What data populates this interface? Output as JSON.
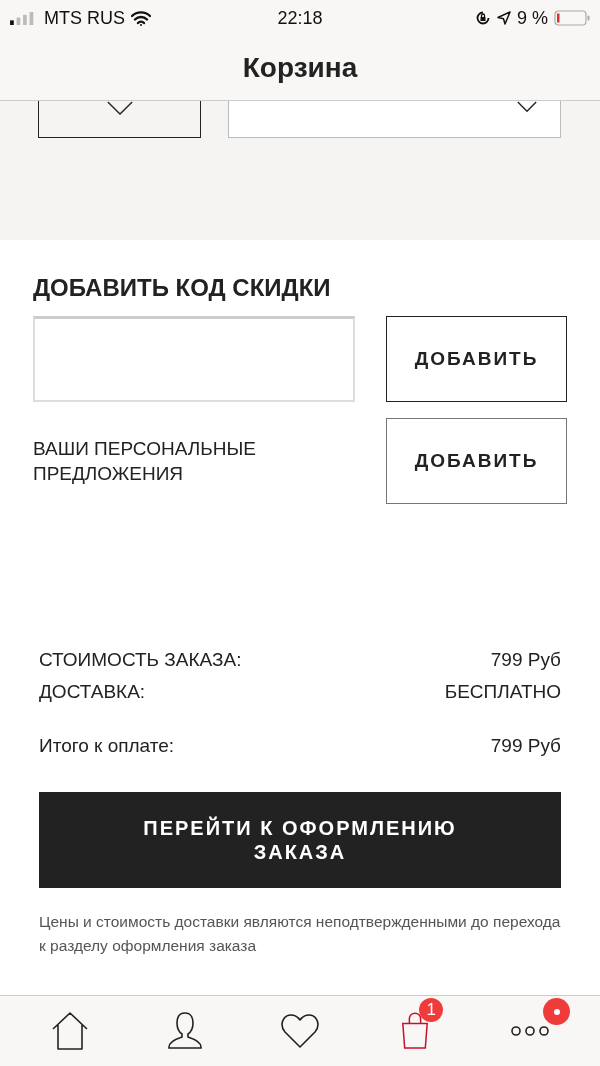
{
  "status_bar": {
    "carrier": "MTS RUS",
    "time": "22:18",
    "battery": "9 %"
  },
  "header": {
    "title": "Корзина"
  },
  "discount": {
    "title": "ДОБАВИТЬ КОД СКИДКИ",
    "button": "ДОБАВИТЬ"
  },
  "offers": {
    "label": "ВАШИ ПЕРСОНАЛЬНЫЕ ПРЕДЛОЖЕНИЯ",
    "button": "ДОБАВИТЬ"
  },
  "summary": [
    {
      "label": "СТОИМОСТЬ ЗАКАЗА:",
      "value": "799 Руб",
      "kind": "line"
    },
    {
      "label": "ДОСТАВКА:",
      "value": "БЕСПЛАТНО",
      "kind": "line"
    },
    {
      "label": "Итого к оплате:",
      "value": "799 Руб",
      "kind": "total"
    }
  ],
  "checkout_button": "ПЕРЕЙТИ К ОФОРМЛЕНИЮ ЗАКАЗА",
  "disclaimer": "Цены и стоимость доставки являются неподтвержденными до перехода к разделу оформления заказа",
  "tab_bar": [
    {
      "kind": "home",
      "selected": false
    },
    {
      "kind": "profile",
      "selected": false
    },
    {
      "kind": "wishlist",
      "selected": false
    },
    {
      "kind": "bag",
      "selected": true,
      "badge": "1"
    },
    {
      "kind": "more",
      "selected": false,
      "dot": true
    }
  ]
}
